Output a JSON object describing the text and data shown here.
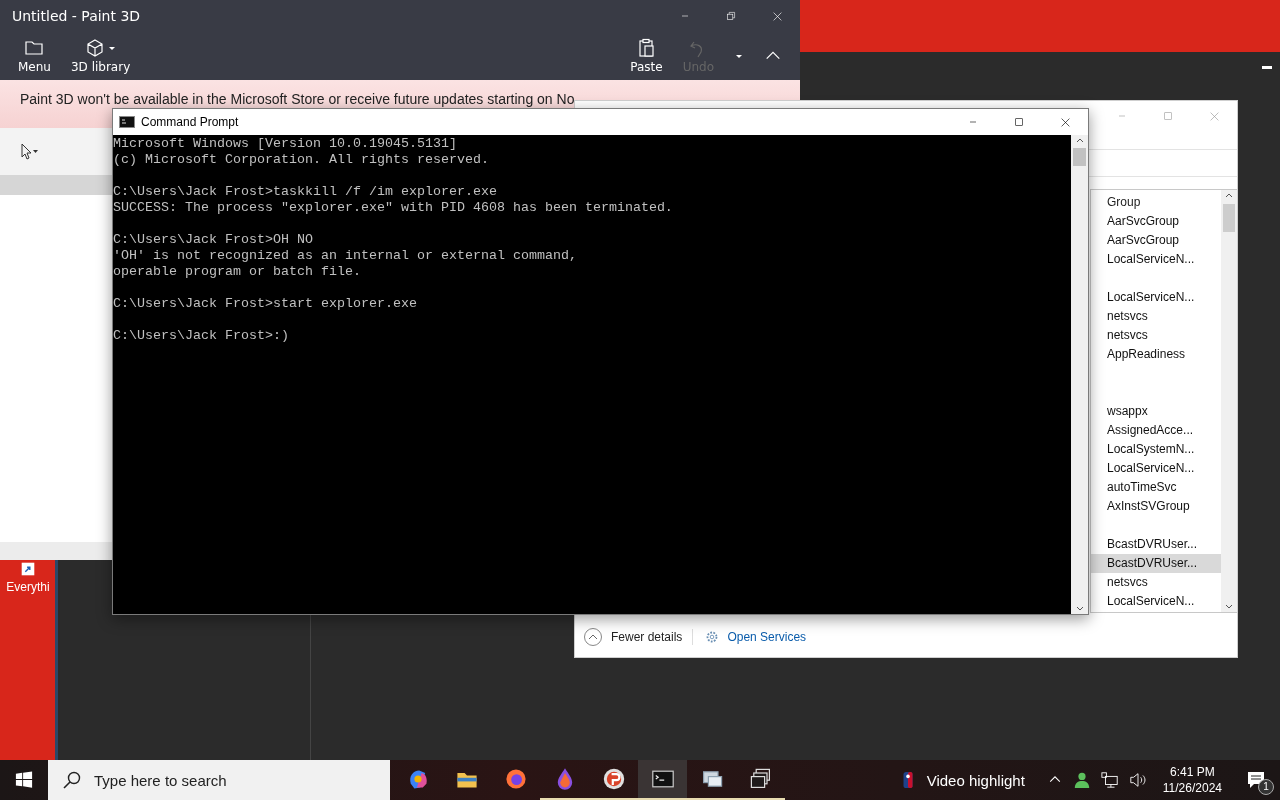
{
  "desktop": {
    "icons": [
      {
        "label": "Everythi"
      }
    ]
  },
  "paint3d": {
    "title": "Untitled - Paint 3D",
    "toolbar_left": [
      {
        "kind": "folder",
        "label": "Menu"
      },
      {
        "kind": "library",
        "label": "3D library"
      }
    ],
    "toolbar_right": [
      {
        "kind": "paste",
        "label": "Paste",
        "disabled": false
      },
      {
        "kind": "undo",
        "label": "Undo",
        "disabled": true
      }
    ],
    "banner": "Paint 3D won't be available in the Microsoft Store or receive future updates starting on No"
  },
  "services_window": {
    "column_header": "Group",
    "rows": [
      {
        "kind": "entry",
        "text": "AarSvcGroup",
        "selected": false
      },
      {
        "kind": "entry",
        "text": "AarSvcGroup",
        "selected": false
      },
      {
        "kind": "entry",
        "text": "LocalServiceN...",
        "selected": false
      },
      {
        "kind": "blank"
      },
      {
        "kind": "entry",
        "text": "LocalServiceN...",
        "selected": false
      },
      {
        "kind": "entry",
        "text": "netsvcs",
        "selected": false
      },
      {
        "kind": "entry",
        "text": "netsvcs",
        "selected": false
      },
      {
        "kind": "entry",
        "text": "AppReadiness",
        "selected": false
      },
      {
        "kind": "blank"
      },
      {
        "kind": "blank"
      },
      {
        "kind": "entry",
        "text": "wsappx",
        "selected": false
      },
      {
        "kind": "entry",
        "text": "AssignedAcce...",
        "selected": false
      },
      {
        "kind": "entry",
        "text": "LocalSystemN...",
        "selected": false
      },
      {
        "kind": "entry",
        "text": "LocalServiceN...",
        "selected": false
      },
      {
        "kind": "entry",
        "text": "autoTimeSvc",
        "selected": false
      },
      {
        "kind": "entry",
        "text": "AxInstSVGroup",
        "selected": false
      },
      {
        "kind": "blank"
      },
      {
        "kind": "entry",
        "text": "BcastDVRUser...",
        "selected": false
      },
      {
        "kind": "entry",
        "text": "BcastDVRUser...",
        "selected": true
      },
      {
        "kind": "entry",
        "text": "netsvcs",
        "selected": false
      },
      {
        "kind": "entry",
        "text": "LocalServiceN...",
        "selected": false
      }
    ],
    "fewer_details": "Fewer details",
    "open_services": "Open Services"
  },
  "cmd": {
    "title": "Command Prompt",
    "blocks": [
      [
        "Microsoft Windows [Version 10.0.19045.5131]",
        "(c) Microsoft Corporation. All rights reserved."
      ],
      [
        "C:\\Users\\Jack Frost>taskkill /f /im explorer.exe",
        "SUCCESS: The process \"explorer.exe\" with PID 4608 has been terminated."
      ],
      [
        "C:\\Users\\Jack Frost>OH NO",
        "'OH' is not recognized as an internal or external command,",
        "operable program or batch file."
      ],
      [
        "C:\\Users\\Jack Frost>start explorer.exe"
      ],
      [
        "C:\\Users\\Jack Frost>:)"
      ]
    ]
  },
  "taskbar": {
    "search_placeholder": "Type here to search",
    "apps": [
      {
        "kind": "copilot",
        "running": false,
        "active": false
      },
      {
        "kind": "folder",
        "running": false,
        "active": false
      },
      {
        "kind": "firefox",
        "running": false,
        "active": false
      },
      {
        "kind": "drop",
        "running": true,
        "active": false
      },
      {
        "kind": "paint",
        "running": true,
        "active": false
      },
      {
        "kind": "terminal",
        "running": true,
        "active": true
      },
      {
        "kind": "computer",
        "running": true,
        "active": false
      },
      {
        "kind": "windows",
        "running": true,
        "active": false
      }
    ],
    "news": "Video highlight",
    "time": "6:41 PM",
    "date": "11/26/2024",
    "notifications": "1"
  }
}
